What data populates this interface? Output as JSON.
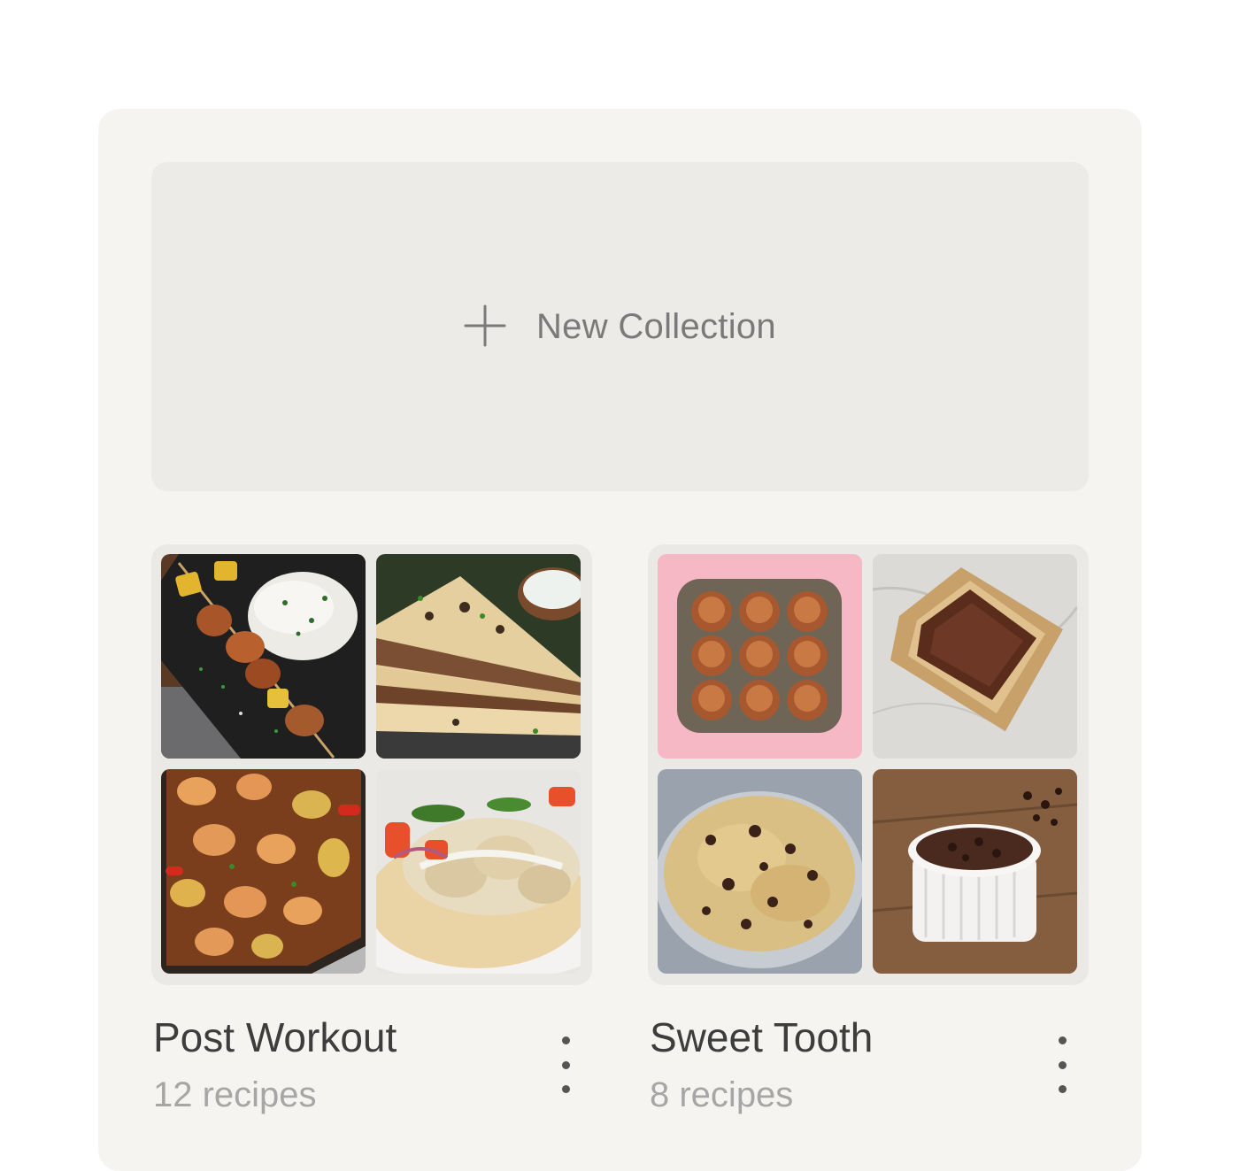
{
  "new_collection": {
    "label": "New Collection",
    "icon": "plus-icon"
  },
  "collections": [
    {
      "title": "Post Workout",
      "count_label": "12 recipes",
      "images": [
        "chicken-pineapple-skewers-rice",
        "beef-stuffed-flatbread",
        "shrimp-potato-sheet-pan",
        "grilled-chicken-pita"
      ],
      "menu_icon": "more-vertical-icon"
    },
    {
      "title": "Sweet Tooth",
      "count_label": "8 recipes",
      "images": [
        "chocolate-chip-muffins",
        "brownie-loaf",
        "cookie-dough-bowl",
        "mug-cake-ramekin"
      ],
      "menu_icon": "more-vertical-icon"
    }
  ],
  "colors": {
    "page_background": "#ffffff",
    "panel_background": "#f5f4f0",
    "new_collection_background": "#edebe7",
    "title_text": "#3d3d3d",
    "subtitle_text": "#a6a6a6"
  }
}
